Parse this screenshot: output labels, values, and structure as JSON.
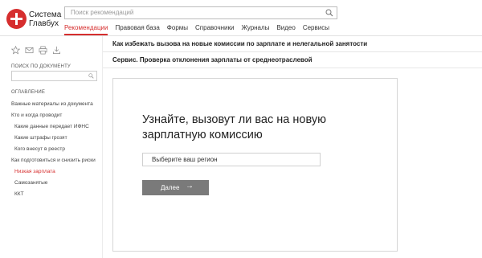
{
  "brand": {
    "line1": "Система",
    "line2": "Главбух",
    "accent": "#d62e2e"
  },
  "search": {
    "placeholder": "Поиск рекомендаций"
  },
  "nav": {
    "items": [
      {
        "label": "Рекомендации",
        "active": true
      },
      {
        "label": "Правовая база"
      },
      {
        "label": "Формы"
      },
      {
        "label": "Справочники"
      },
      {
        "label": "Журналы"
      },
      {
        "label": "Видео"
      },
      {
        "label": "Сервисы"
      }
    ]
  },
  "sidebar": {
    "tools": [
      "star-icon",
      "mail-icon",
      "print-icon",
      "download-icon"
    ],
    "doc_search_label": "ПОИСК ПО ДОКУМЕНТУ",
    "toc_label": "ОГЛАВЛЕНИЕ",
    "toc": [
      {
        "label": "Важные материалы из документа"
      },
      {
        "label": "Кто и когда проводит"
      },
      {
        "label": "Какие данные передает ИФНС"
      },
      {
        "label": "Какие штрафы грозят"
      },
      {
        "label": "Кого внесут в реестр"
      },
      {
        "label": "Как подготовиться и снизить риски"
      },
      {
        "label": "Низкая зарплата",
        "active": true
      },
      {
        "label": "Самозанятые"
      },
      {
        "label": "ККТ"
      }
    ]
  },
  "main": {
    "title": "Как избежать вызова на новые комиссии по зарплате и нелегальной занятости",
    "subtitle": "Сервис. Проверка отклонения зарплаты от среднеотраслевой",
    "card": {
      "heading": "Узнайте, вызовут ли вас на новую зарплатную комиссию",
      "region_placeholder": "Выберите ваш регион",
      "next_label": "Далее",
      "next_arrow": "→"
    }
  }
}
